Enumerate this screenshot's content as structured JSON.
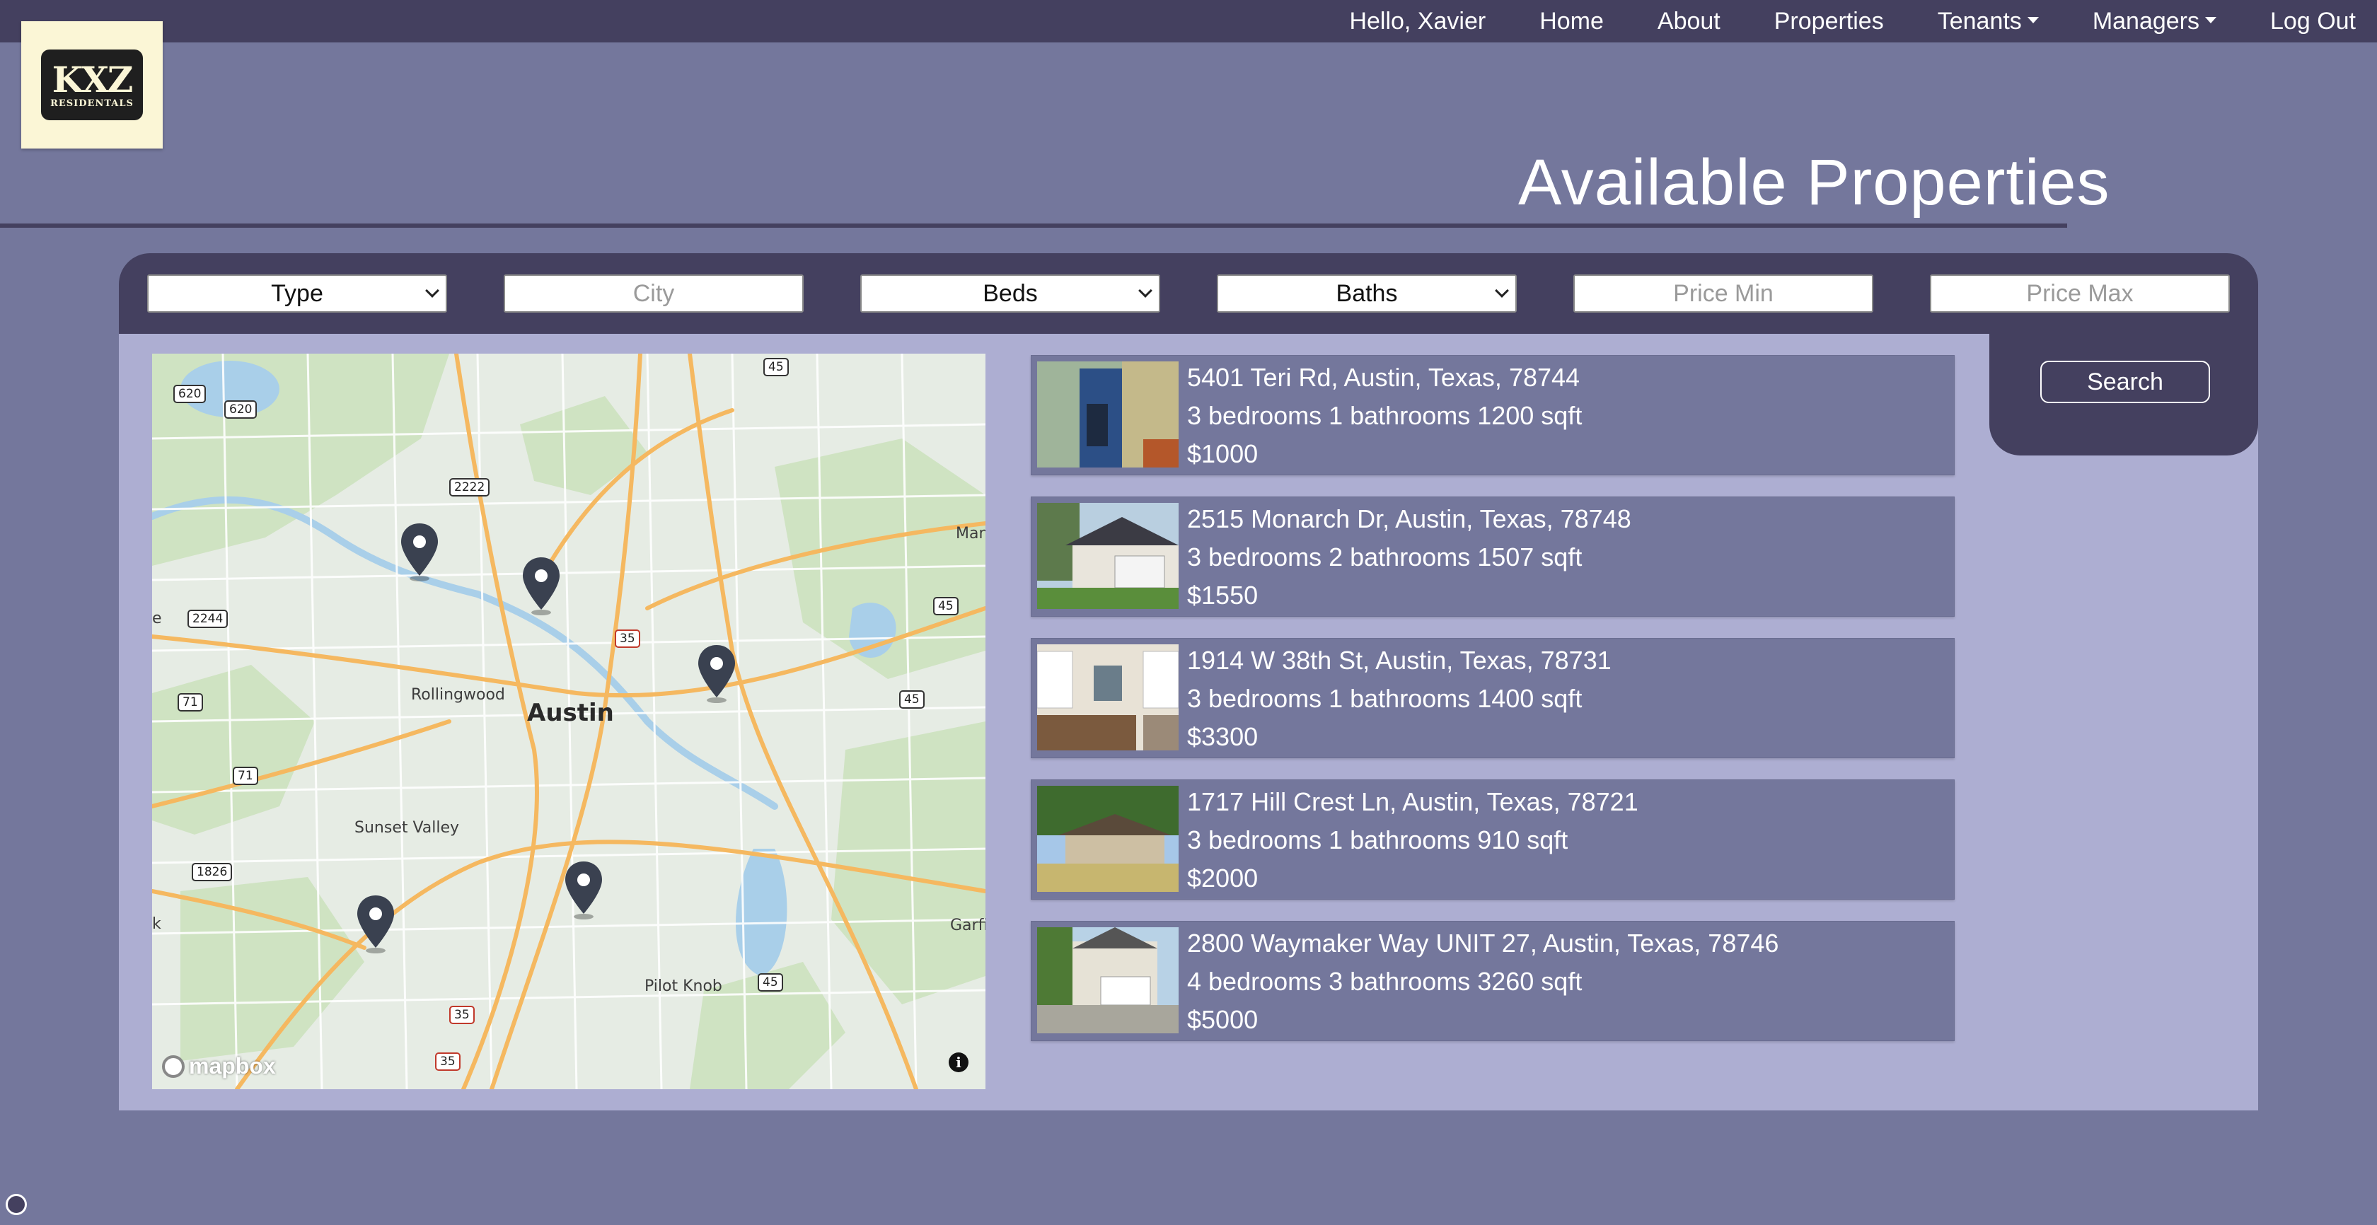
{
  "nav": {
    "greeting": "Hello, Xavier",
    "home": "Home",
    "about": "About",
    "properties": "Properties",
    "tenants": "Tenants",
    "managers": "Managers",
    "logout": "Log Out"
  },
  "logo": {
    "mark": "KXZ",
    "sub": "RESIDENTALS"
  },
  "page_title": "Available Properties",
  "filters": {
    "type": "Type",
    "city_placeholder": "City",
    "beds": "Beds",
    "baths": "Baths",
    "price_min_placeholder": "Price Min",
    "price_max_placeholder": "Price Max"
  },
  "search_label": "Search",
  "map": {
    "city_label": "Austin",
    "labels": [
      "Rollingwood",
      "Sunset Valley",
      "Pilot Knob",
      "Man",
      "Garfi",
      "e",
      "k"
    ],
    "highways": [
      "620",
      "620",
      "2222",
      "2244",
      "71",
      "71",
      "1826",
      "45",
      "45",
      "45",
      "45",
      "35",
      "35",
      "35"
    ],
    "attribution": "mapbox",
    "info": "i"
  },
  "listings": [
    {
      "address": "5401 Teri Rd, Austin, Texas, 78744",
      "details": "3 bedrooms 1 bathrooms 1200 sqft",
      "price": "$1000"
    },
    {
      "address": "2515 Monarch Dr, Austin, Texas, 78748",
      "details": "3 bedrooms 2 bathrooms 1507 sqft",
      "price": "$1550"
    },
    {
      "address": "1914 W 38th St, Austin, Texas, 78731",
      "details": "3 bedrooms 1 bathrooms 1400 sqft",
      "price": "$3300"
    },
    {
      "address": "1717 Hill Crest Ln, Austin, Texas, 78721",
      "details": "3 bedrooms 1 bathrooms 910 sqft",
      "price": "$2000"
    },
    {
      "address": "2800 Waymaker Way UNIT 27, Austin, Texas, 78746",
      "details": "4 bedrooms 3 bathrooms 3260 sqft",
      "price": "$5000"
    }
  ],
  "colors": {
    "background": "#74779c",
    "nav": "#44405f",
    "panel_body": "#adaed2",
    "logo_bg": "#fbf6d6"
  }
}
